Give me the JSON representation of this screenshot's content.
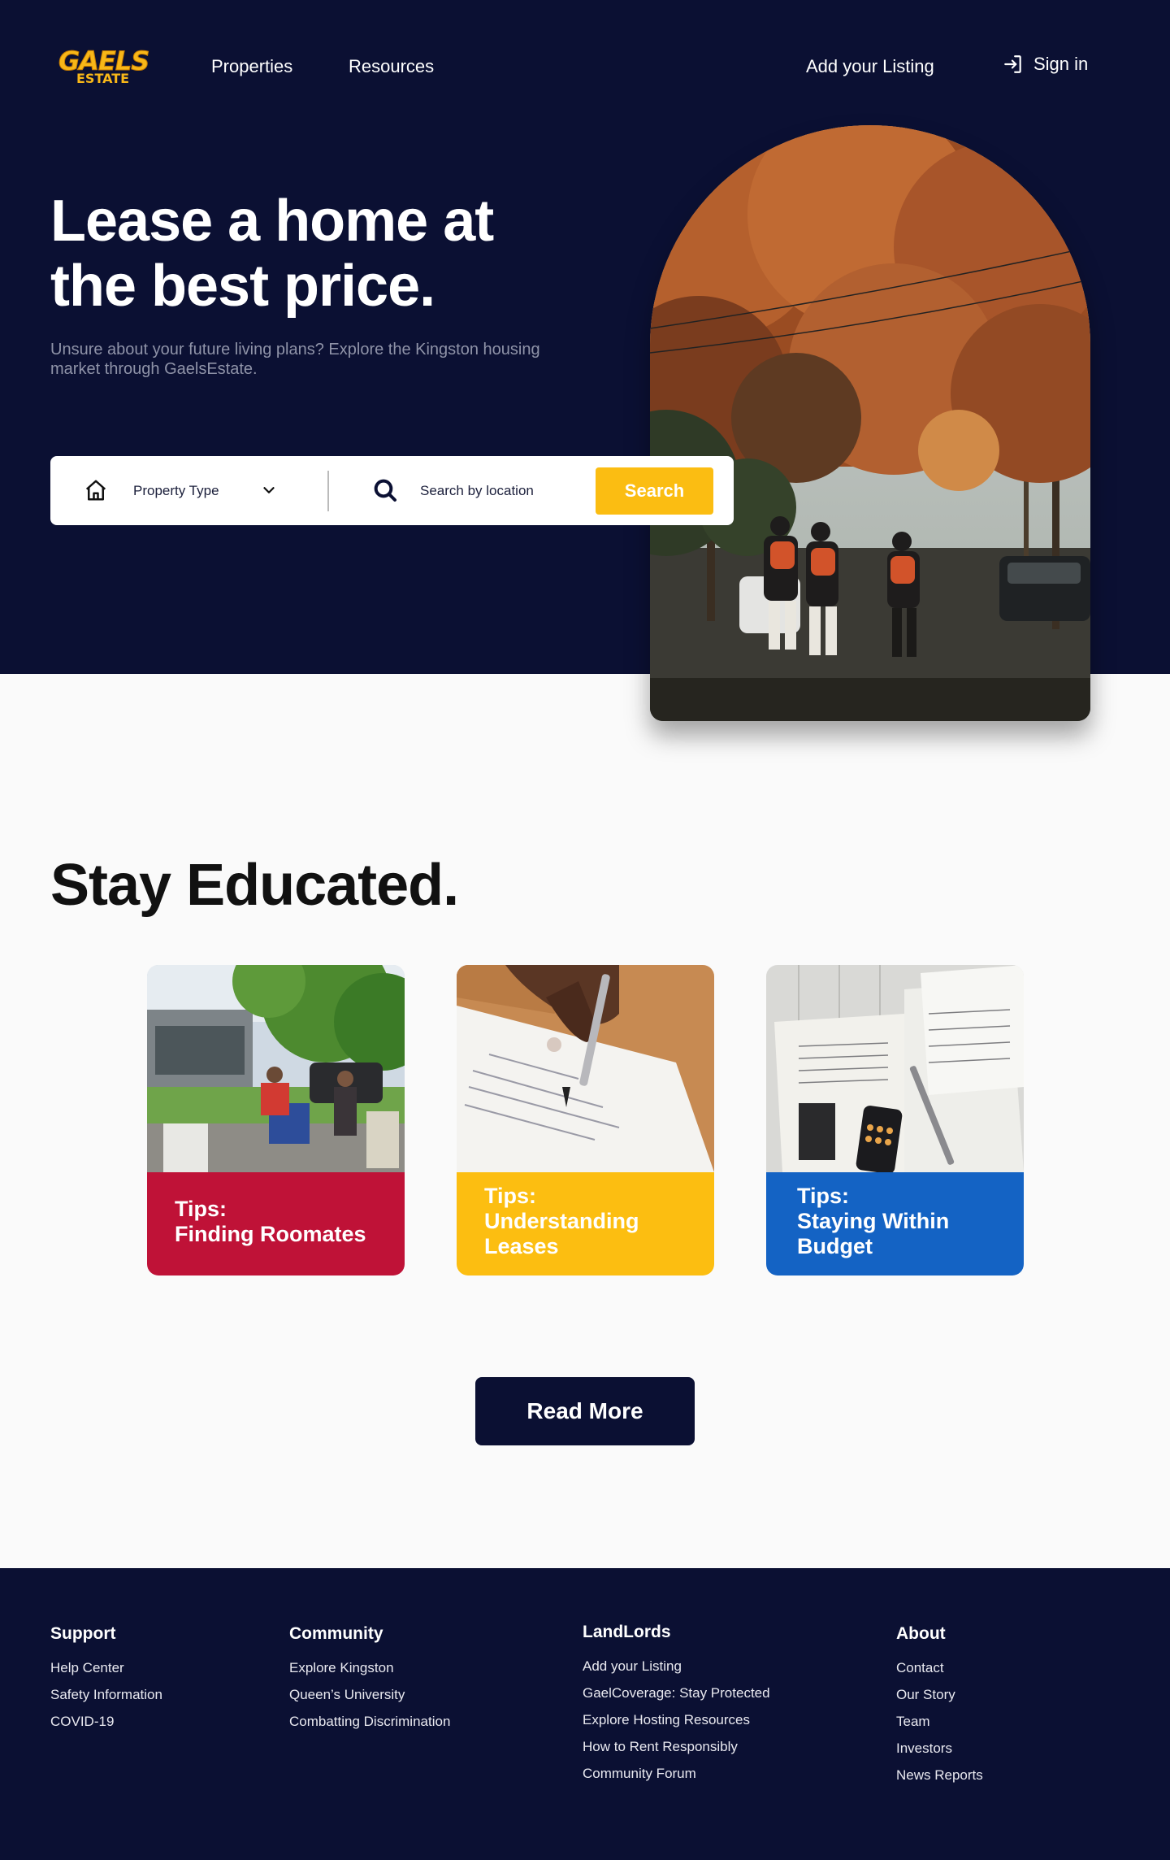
{
  "brand": {
    "logo_line1": "GAELS",
    "logo_line2": "ESTATE",
    "accent": "#fbbd12",
    "navy": "#0b1033"
  },
  "nav": {
    "properties": "Properties",
    "resources": "Resources",
    "add_listing": "Add your Listing",
    "sign_in": "Sign in"
  },
  "hero": {
    "title": "Lease a home at the best price.",
    "subtitle": "Unsure about your future living plans? Explore the Kingston housing market through GaelsEstate."
  },
  "search": {
    "property_type": "Property Type",
    "location_placeholder": "Search by location",
    "button": "Search"
  },
  "education": {
    "title": "Stay Educated.",
    "cards": [
      {
        "label": "Tips:\nFinding Roomates",
        "color": "#bf1237"
      },
      {
        "label": "Tips:\nUnderstanding Leases",
        "color": "#fcbe11"
      },
      {
        "label": "Tips:\nStaying Within Budget",
        "color": "#1463c4"
      }
    ],
    "read_more": "Read More"
  },
  "footer": {
    "columns": [
      {
        "heading": "Support",
        "links": [
          "Help Center",
          "Safety Information",
          "COVID-19"
        ]
      },
      {
        "heading": "Community",
        "links": [
          "Explore Kingston",
          "Queen’s University",
          "Combatting Discrimination"
        ]
      },
      {
        "heading": "LandLords",
        "links": [
          "Add your Listing",
          "GaelCoverage: Stay Protected",
          "Explore Hosting Resources",
          "How to Rent Responsibly",
          "Community Forum"
        ]
      },
      {
        "heading": "About",
        "links": [
          "Contact",
          "Our Story",
          "Team",
          "Investors",
          "News Reports"
        ]
      }
    ]
  }
}
